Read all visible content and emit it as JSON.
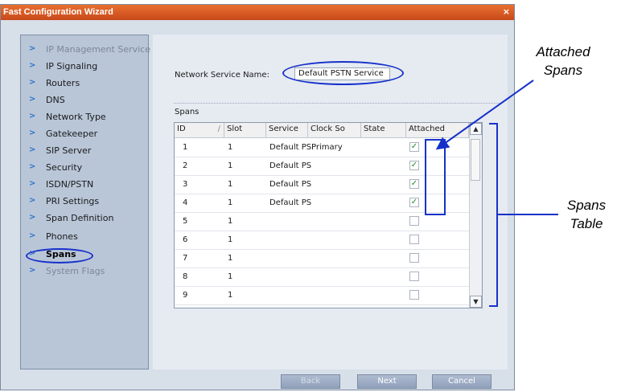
{
  "window": {
    "title": "Fast Configuration Wizard",
    "close_glyph": "×"
  },
  "sidebar": {
    "items": [
      {
        "label": "IP Management Service",
        "state": "disabled"
      },
      {
        "label": "IP Signaling",
        "state": "normal"
      },
      {
        "label": "Routers",
        "state": "normal"
      },
      {
        "label": "DNS",
        "state": "normal"
      },
      {
        "label": "Network Type",
        "state": "normal"
      },
      {
        "label": "Gatekeeper",
        "state": "normal"
      },
      {
        "label": "SIP Server",
        "state": "normal"
      },
      {
        "label": "Security",
        "state": "normal"
      },
      {
        "label": "ISDN/PSTN",
        "state": "normal"
      },
      {
        "label": "PRI Settings",
        "state": "normal"
      },
      {
        "label": "Span Definition",
        "state": "normal"
      },
      {
        "label": "Phones",
        "state": "normal"
      },
      {
        "label": "Spans",
        "state": "selected"
      },
      {
        "label": "System Flags",
        "state": "disabled"
      }
    ]
  },
  "form": {
    "network_service_label": "Network Service Name:",
    "network_service_value": "Default PSTN Service",
    "spans_label": "Spans"
  },
  "table": {
    "columns": [
      "ID",
      "Slot",
      "Service",
      "Clock So",
      "State",
      "Attached"
    ],
    "sort_glyph": "/",
    "rows": [
      {
        "id": "1",
        "slot": "1",
        "service": "Default PS",
        "clock": "Primary",
        "state": "",
        "attached": true
      },
      {
        "id": "2",
        "slot": "1",
        "service": "Default PS",
        "clock": "",
        "state": "",
        "attached": true
      },
      {
        "id": "3",
        "slot": "1",
        "service": "Default PS",
        "clock": "",
        "state": "",
        "attached": true
      },
      {
        "id": "4",
        "slot": "1",
        "service": "Default PS",
        "clock": "",
        "state": "",
        "attached": true
      },
      {
        "id": "5",
        "slot": "1",
        "service": "",
        "clock": "",
        "state": "",
        "attached": false
      },
      {
        "id": "6",
        "slot": "1",
        "service": "",
        "clock": "",
        "state": "",
        "attached": false
      },
      {
        "id": "7",
        "slot": "1",
        "service": "",
        "clock": "",
        "state": "",
        "attached": false
      },
      {
        "id": "8",
        "slot": "1",
        "service": "",
        "clock": "",
        "state": "",
        "attached": false
      },
      {
        "id": "9",
        "slot": "1",
        "service": "",
        "clock": "",
        "state": "",
        "attached": false
      }
    ]
  },
  "buttons": {
    "back": "Back",
    "next": "Next",
    "cancel": "Cancel"
  },
  "callouts": {
    "attached_spans": "Attached\nSpans",
    "spans_table": "Spans\nTable"
  },
  "colors": {
    "title_bar": "#d8561f",
    "annotation": "#1631c9",
    "sidebar": "#b9c6d8",
    "check": "#1d8a2a"
  }
}
